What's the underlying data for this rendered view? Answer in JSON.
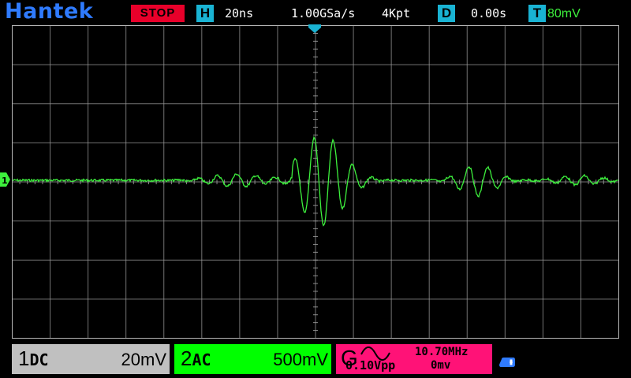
{
  "header": {
    "logo": "Hantek",
    "run_state": "STOP",
    "horizontal": {
      "tag": "H",
      "timebase": "20ns"
    },
    "sample_rate": "1.00GSa/s",
    "memory_depth": "4Kpt",
    "delay": {
      "tag": "D",
      "value": "0.00s"
    },
    "trigger": {
      "tag": "T",
      "level": "80mV"
    }
  },
  "channels": [
    {
      "number": "1",
      "coupling": "DC",
      "scale": "20mV",
      "color": "#c0c0c0"
    },
    {
      "number": "2",
      "coupling": "AC",
      "scale": "500mV",
      "color": "#00ff00"
    }
  ],
  "generator": {
    "letter": "G",
    "waveform_icon": "sine-wave-icon",
    "frequency": "10.70MHz",
    "amplitude": "0.10Vpp",
    "offset": "0mv",
    "color": "#ff1277"
  },
  "markers": {
    "ground_marker": "1",
    "trigger_position_icon": "trigger-position-icon"
  },
  "usb_icon": "usb-icon",
  "colors": {
    "trace": "#3df03d",
    "grid": "#9a9a9a",
    "accent": "#19b3d3",
    "stop": "#e8002a"
  }
}
